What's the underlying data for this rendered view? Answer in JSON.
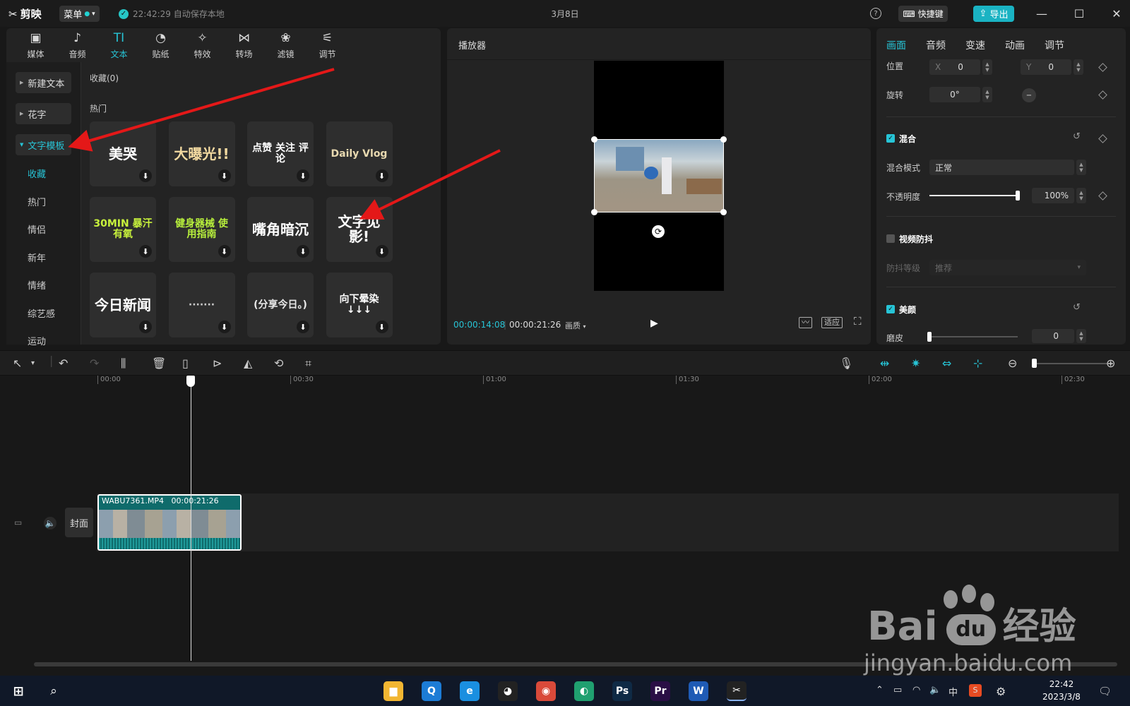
{
  "app": {
    "name": "剪映",
    "menu_label": "菜单",
    "autosave": "22:42:29 自动保存本地",
    "project_title": "3月8日",
    "shortcut_label": "快捷键",
    "export_label": "导出",
    "help_glyph": "?"
  },
  "media_tabs": [
    {
      "label": "媒体",
      "icon": "media-icon",
      "glyph": "▣"
    },
    {
      "label": "音频",
      "icon": "audio-icon",
      "glyph": "♪"
    },
    {
      "label": "文本",
      "icon": "text-icon",
      "glyph": "TI"
    },
    {
      "label": "贴纸",
      "icon": "sticker-icon",
      "glyph": "◔"
    },
    {
      "label": "特效",
      "icon": "effects-icon",
      "glyph": "✧"
    },
    {
      "label": "转场",
      "icon": "transition-icon",
      "glyph": "⋈"
    },
    {
      "label": "滤镜",
      "icon": "filter-icon",
      "glyph": "❀"
    },
    {
      "label": "调节",
      "icon": "adjust-icon",
      "glyph": "⚟"
    }
  ],
  "left_nav": {
    "new_text": "新建文本",
    "fancy_text": "花字",
    "text_template": "文字模板",
    "sub": [
      "收藏",
      "热门",
      "情侣",
      "新年",
      "情绪",
      "综艺感",
      "运动"
    ]
  },
  "library": {
    "favorites": "收藏(0)",
    "hot": "热门",
    "templates": [
      {
        "label": "美哭",
        "color": "#ffffff",
        "bg": "#2e2e2e"
      },
      {
        "label": "大曝光!!",
        "color": "#f2d9a0",
        "bg": "#2e2e2e"
      },
      {
        "label": "点赞 关注 评论",
        "color": "#ffffff",
        "bg": "#2e2e2e"
      },
      {
        "label": "Daily Vlog",
        "color": "#e8d9b0",
        "bg": "#2e2e2e"
      },
      {
        "label": "30MIN 暴汗有氧",
        "color": "#c8f23c",
        "bg": "#2e2e2e"
      },
      {
        "label": "健身器械 使用指南",
        "color": "#b8f03c",
        "bg": "#2e2e2e"
      },
      {
        "label": "嘴角暗沉",
        "color": "#ffffff",
        "bg": "#2e2e2e"
      },
      {
        "label": "文字见影!",
        "color": "#ffffff",
        "bg": "#2e2e2e"
      },
      {
        "label": "今日新闻",
        "color": "#ffffff",
        "bg": "#2e2e2e"
      },
      {
        "label": "·······",
        "color": "#cccccc",
        "bg": "#2e2e2e"
      },
      {
        "label": "(分享今日。)",
        "color": "#e8e8e8",
        "bg": "#2e2e2e"
      },
      {
        "label": "向下晕染 ↓↓↓",
        "color": "#ffffff",
        "bg": "#2e2e2e"
      }
    ],
    "download_glyph": "⬇"
  },
  "player": {
    "title": "播放器",
    "current_time": "00:00:14:08",
    "total_time": "00:00:21:26",
    "quality_label": "画质",
    "fit_label": "适应"
  },
  "props": {
    "tabs": [
      "画面",
      "音频",
      "变速",
      "动画",
      "调节"
    ],
    "position_label": "位置",
    "x_label": "X",
    "x_value": "0",
    "y_label": "Y",
    "y_value": "0",
    "rotate_label": "旋转",
    "rotate_value": "0°",
    "blend_title": "混合",
    "blend_mode_label": "混合模式",
    "blend_mode_value": "正常",
    "opacity_label": "不透明度",
    "opacity_value": "100%",
    "opacity_fraction": 1.0,
    "stabilize_title": "视频防抖",
    "stabilize_level_label": "防抖等级",
    "stabilize_level_value": "推荐",
    "beauty_title": "美颜",
    "smooth_label": "磨皮",
    "smooth_value": "0",
    "smooth_fraction": 0.0
  },
  "timeline": {
    "ruler_labels": [
      "00:00",
      "00:30",
      "01:00",
      "01:30",
      "02:00",
      "02:30"
    ],
    "clip_name": "WABU7361.MP4",
    "clip_duration": "00:00:21:26",
    "cover_label": "封面"
  },
  "watermark": {
    "brand": "Bai",
    "brand2": "du",
    "suffix": "经验",
    "url": "jingyan.baidu.com"
  },
  "taskbar": {
    "apps": [
      {
        "name": "file-explorer",
        "glyph": "▆",
        "color": "#f2b632"
      },
      {
        "name": "search-app",
        "glyph": "Q",
        "color": "#1c7cd6"
      },
      {
        "name": "edge-legacy",
        "glyph": "e",
        "color": "#1a8fe0"
      },
      {
        "name": "qq",
        "glyph": "◕",
        "color": "#222222"
      },
      {
        "name": "chrome",
        "glyph": "◉",
        "color": "#d94a3a"
      },
      {
        "name": "edge",
        "glyph": "◐",
        "color": "#20a070"
      },
      {
        "name": "photoshop",
        "glyph": "Ps",
        "color": "#0f2a45"
      },
      {
        "name": "premiere",
        "glyph": "Pr",
        "color": "#2a0f45"
      },
      {
        "name": "word",
        "glyph": "W",
        "color": "#1f5bb5"
      },
      {
        "name": "capcut",
        "glyph": "✂",
        "color": "#222222"
      }
    ],
    "ime": "中",
    "time": "22:42",
    "date": "2023/3/8"
  },
  "colors": {
    "accent": "#27c4d6",
    "annotation_arrow": "#e41818"
  }
}
